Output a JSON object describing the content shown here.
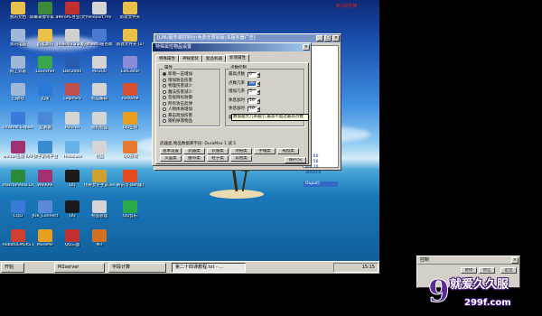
{
  "desktop": {
    "icons": [
      {
        "label": "我的文档",
        "icon": "folder-icon",
        "color": "#e8c04a"
      },
      {
        "label": "屏幕录像专家 V7.5",
        "icon": "recorder-icon",
        "color": "#3a8a3a"
      },
      {
        "label": "HeroPE寻宝(文件).exe",
        "icon": "app-icon",
        "color": "#c03030"
      },
      {
        "label": "Teleport Pro",
        "icon": "teleport-icon",
        "color": "#d4d4d4"
      },
      {
        "label": "新建文件夹",
        "icon": "folder-icon",
        "color": "#e8c04a"
      },
      {
        "label": "我的电脑",
        "icon": "computer-icon",
        "color": "#9fb8d8"
      },
      {
        "label": "韵选源码",
        "icon": "folder-icon",
        "color": "#e8c04a"
      },
      {
        "label": "HHB-V3.3.2发户端服务版",
        "icon": "server-icon",
        "color": "#d0d0d0"
      },
      {
        "label": "zhentu服务端",
        "icon": "server-icon",
        "color": "#4a7ad0"
      },
      {
        "label": "新建文件夹 (2)",
        "icon": "folder-icon",
        "color": "#e8c04a"
      },
      {
        "label": "网上邻居",
        "icon": "network-icon",
        "color": "#9fb8d8"
      },
      {
        "label": "Launcher",
        "icon": "launcher-icon",
        "color": "#3aa84a"
      },
      {
        "label": "Dbc2000",
        "icon": "database-icon",
        "color": "#2a5ab0"
      },
      {
        "label": "Mir200",
        "icon": "mir-icon",
        "color": "#d4d4d4"
      },
      {
        "label": "ExtEditor",
        "icon": "editor-icon",
        "color": "#8a8ad8"
      },
      {
        "label": "回收站",
        "icon": "recycle-bin-icon",
        "color": "#9fb8d8"
      },
      {
        "label": "迅雷",
        "icon": "thunder-icon",
        "color": "#2a78d8"
      },
      {
        "label": "LoginSrv",
        "icon": "login-icon",
        "color": "#c05050"
      },
      {
        "label": "物品编辑",
        "icon": "item-editor-icon",
        "color": "#d4d4d4"
      },
      {
        "label": "Runtime",
        "icon": "runtime-icon",
        "color": "#d85030"
      },
      {
        "label": "Internet Explorer",
        "icon": "ie-icon",
        "color": "#3a7ad8"
      },
      {
        "label": "登录器",
        "icon": "login-icon",
        "color": "#4a88d8"
      },
      {
        "label": "Mirchin",
        "icon": "mir-icon",
        "color": "#d4d4d4"
      },
      {
        "label": "随机物品",
        "icon": "item-editor-icon",
        "color": "#d4d4d4"
      },
      {
        "label": "QQ空间",
        "icon": "qzone-icon",
        "color": "#e8a020"
      },
      {
        "label": "winrar压缩 RAR文件",
        "icon": "winrar-icon",
        "color": "#a03070"
      },
      {
        "label": "数字游戏平台",
        "icon": "game-icon",
        "color": "#3a8ad0"
      },
      {
        "label": "Helocase",
        "icon": "app-icon",
        "color": "#6ab0e8"
      },
      {
        "label": "物品",
        "icon": "item-editor-icon",
        "color": "#d4d4d4"
      },
      {
        "label": "QQ游戏",
        "icon": "qqgame-icon",
        "color": "#e87830"
      },
      {
        "label": "Macromedia Dreamwea...",
        "icon": "dreamweaver-icon",
        "color": "#2a8a3a"
      },
      {
        "label": "WinRAR",
        "icon": "winrar-icon",
        "color": "#a03070"
      },
      {
        "label": "QQ",
        "icon": "qq-icon",
        "color": "#1a1a1a"
      },
      {
        "label": "传奇文字手游.exe",
        "icon": "app-icon",
        "color": "#d0a030"
      },
      {
        "label": "腾讯 (Flash版)",
        "icon": "flash-icon",
        "color": "#e84a20"
      },
      {
        "label": "CQLI",
        "icon": "app-icon",
        "color": "#3a7ad8"
      },
      {
        "label": "JOB_Connect",
        "icon": "app-icon",
        "color": "#5a8ad8"
      },
      {
        "label": "QQ",
        "icon": "qq-icon",
        "color": "#1a1a1a"
      },
      {
        "label": "物品管理",
        "icon": "item-editor-icon",
        "color": "#d4d4d4"
      },
      {
        "label": "QQ音乐",
        "icon": "qqmusic-icon",
        "color": "#2aa84a"
      },
      {
        "label": "Robot0EMEKS.DEV",
        "icon": "app-icon",
        "color": "#d04030"
      },
      {
        "label": "MoreMir",
        "icon": "mir-icon",
        "color": "#e8a020"
      },
      {
        "label": "QQ三国",
        "icon": "qq-icon",
        "color": "#c03030"
      },
      {
        "label": "Mir",
        "icon": "mir-icon",
        "color": "#d07020"
      }
    ],
    "corner_tag": "新1服务器"
  },
  "bg_window": {
    "title": "[LMU服务端控制台(免费无限制版)本服务器广告]",
    "side_lines": [
      "",
      "",
      "",
      "",
      "",
      "",
      "",
      "",
      "",
      "",
      "",
      "",
      "",
      "",
      "",
      "",
      "",
      "",
      "",
      "",
      "8/9:60",
      "8/9:56",
      "8/9:70",
      "30/10:0",
      "",
      "Ouput]"
    ]
  },
  "main_dialog": {
    "title": "特殊属性物品设置",
    "tabs": [
      "特殊属性",
      "神秘套装",
      "套品机器",
      "新增属性"
    ],
    "selected_tab": 3,
    "group_left": {
      "title": "属性",
      "radios": [
        {
          "label": "新增一击增加",
          "checked": true
        },
        {
          "label": "增加防击伤害",
          "checked": false
        },
        {
          "label": "物理伤害减少",
          "checked": false
        },
        {
          "label": "魔法伤害减少",
          "checked": false
        },
        {
          "label": "忽视目标防御",
          "checked": false
        },
        {
          "label": "所有攻击反弹",
          "checked": false
        },
        {
          "label": "人物体质增加",
          "checked": false
        },
        {
          "label": "暴击附加伤害",
          "checked": false
        },
        {
          "label": "随机掉落物品",
          "checked": false
        }
      ]
    },
    "group_right": {
      "title": "点数控制",
      "fields": [
        {
          "label": "最高点数",
          "value": "0"
        },
        {
          "label": "点数几率",
          "value": "99"
        },
        {
          "label": "增加几率",
          "value": "5"
        },
        {
          "label": "休息加时",
          "value": "10"
        },
        {
          "label": "休息加时",
          "value": "10"
        },
        {
          "label": "最多倍值",
          "value": "5"
        }
      ]
    },
    "tooltip": "数值越大几率越小,最高不超过最高点数",
    "info_line": "武器类,物品数据库字段: DuraMax 1 减 5",
    "buttons_row1": [
      "基本设置",
      "武器类",
      "衣服类",
      "项链类",
      "手镯类",
      "戒指类"
    ],
    "buttons_row2": [
      "头盔类",
      "腰带类",
      "鞋子类",
      "其他类"
    ],
    "save_label": "保存(S)"
  },
  "taskbar": {
    "start_label": "开始",
    "buttons": [
      {
        "label": "M2server",
        "active": false
      },
      {
        "label": "字段计算",
        "active": false
      },
      {
        "label": "第二十四课教程.txt - ...",
        "active": true
      }
    ],
    "clock": "15:15"
  },
  "control_window": {
    "title": "控制",
    "buttons": [
      "暂停",
      "停止",
      "定位"
    ]
  },
  "watermark": {
    "text": "就爱久久服",
    "url": "299f.com",
    "glyph": "9"
  }
}
